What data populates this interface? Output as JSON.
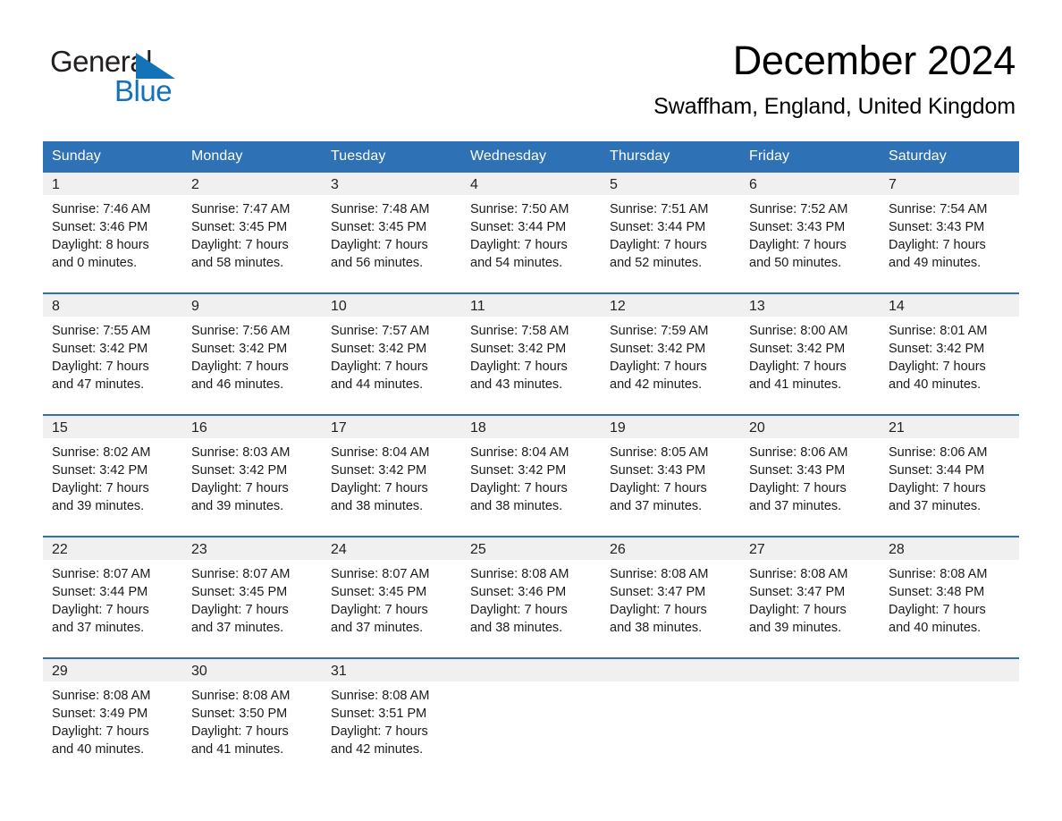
{
  "logo": {
    "word1": "General",
    "word2": "Blue",
    "triangle_color": "#1373b8",
    "text_color": "#231f20"
  },
  "header": {
    "title": "December 2024",
    "subtitle": "Swaffham, England, United Kingdom",
    "header_bg_color": "#2e71b5",
    "daynum_bg_color": "#f0f0f0"
  },
  "weekdays": [
    "Sunday",
    "Monday",
    "Tuesday",
    "Wednesday",
    "Thursday",
    "Friday",
    "Saturday"
  ],
  "weeks": [
    [
      {
        "day": "1",
        "sunrise": "Sunrise: 7:46 AM",
        "sunset": "Sunset: 3:46 PM",
        "daylight1": "Daylight: 8 hours",
        "daylight2": "and 0 minutes."
      },
      {
        "day": "2",
        "sunrise": "Sunrise: 7:47 AM",
        "sunset": "Sunset: 3:45 PM",
        "daylight1": "Daylight: 7 hours",
        "daylight2": "and 58 minutes."
      },
      {
        "day": "3",
        "sunrise": "Sunrise: 7:48 AM",
        "sunset": "Sunset: 3:45 PM",
        "daylight1": "Daylight: 7 hours",
        "daylight2": "and 56 minutes."
      },
      {
        "day": "4",
        "sunrise": "Sunrise: 7:50 AM",
        "sunset": "Sunset: 3:44 PM",
        "daylight1": "Daylight: 7 hours",
        "daylight2": "and 54 minutes."
      },
      {
        "day": "5",
        "sunrise": "Sunrise: 7:51 AM",
        "sunset": "Sunset: 3:44 PM",
        "daylight1": "Daylight: 7 hours",
        "daylight2": "and 52 minutes."
      },
      {
        "day": "6",
        "sunrise": "Sunrise: 7:52 AM",
        "sunset": "Sunset: 3:43 PM",
        "daylight1": "Daylight: 7 hours",
        "daylight2": "and 50 minutes."
      },
      {
        "day": "7",
        "sunrise": "Sunrise: 7:54 AM",
        "sunset": "Sunset: 3:43 PM",
        "daylight1": "Daylight: 7 hours",
        "daylight2": "and 49 minutes."
      }
    ],
    [
      {
        "day": "8",
        "sunrise": "Sunrise: 7:55 AM",
        "sunset": "Sunset: 3:42 PM",
        "daylight1": "Daylight: 7 hours",
        "daylight2": "and 47 minutes."
      },
      {
        "day": "9",
        "sunrise": "Sunrise: 7:56 AM",
        "sunset": "Sunset: 3:42 PM",
        "daylight1": "Daylight: 7 hours",
        "daylight2": "and 46 minutes."
      },
      {
        "day": "10",
        "sunrise": "Sunrise: 7:57 AM",
        "sunset": "Sunset: 3:42 PM",
        "daylight1": "Daylight: 7 hours",
        "daylight2": "and 44 minutes."
      },
      {
        "day": "11",
        "sunrise": "Sunrise: 7:58 AM",
        "sunset": "Sunset: 3:42 PM",
        "daylight1": "Daylight: 7 hours",
        "daylight2": "and 43 minutes."
      },
      {
        "day": "12",
        "sunrise": "Sunrise: 7:59 AM",
        "sunset": "Sunset: 3:42 PM",
        "daylight1": "Daylight: 7 hours",
        "daylight2": "and 42 minutes."
      },
      {
        "day": "13",
        "sunrise": "Sunrise: 8:00 AM",
        "sunset": "Sunset: 3:42 PM",
        "daylight1": "Daylight: 7 hours",
        "daylight2": "and 41 minutes."
      },
      {
        "day": "14",
        "sunrise": "Sunrise: 8:01 AM",
        "sunset": "Sunset: 3:42 PM",
        "daylight1": "Daylight: 7 hours",
        "daylight2": "and 40 minutes."
      }
    ],
    [
      {
        "day": "15",
        "sunrise": "Sunrise: 8:02 AM",
        "sunset": "Sunset: 3:42 PM",
        "daylight1": "Daylight: 7 hours",
        "daylight2": "and 39 minutes."
      },
      {
        "day": "16",
        "sunrise": "Sunrise: 8:03 AM",
        "sunset": "Sunset: 3:42 PM",
        "daylight1": "Daylight: 7 hours",
        "daylight2": "and 39 minutes."
      },
      {
        "day": "17",
        "sunrise": "Sunrise: 8:04 AM",
        "sunset": "Sunset: 3:42 PM",
        "daylight1": "Daylight: 7 hours",
        "daylight2": "and 38 minutes."
      },
      {
        "day": "18",
        "sunrise": "Sunrise: 8:04 AM",
        "sunset": "Sunset: 3:42 PM",
        "daylight1": "Daylight: 7 hours",
        "daylight2": "and 38 minutes."
      },
      {
        "day": "19",
        "sunrise": "Sunrise: 8:05 AM",
        "sunset": "Sunset: 3:43 PM",
        "daylight1": "Daylight: 7 hours",
        "daylight2": "and 37 minutes."
      },
      {
        "day": "20",
        "sunrise": "Sunrise: 8:06 AM",
        "sunset": "Sunset: 3:43 PM",
        "daylight1": "Daylight: 7 hours",
        "daylight2": "and 37 minutes."
      },
      {
        "day": "21",
        "sunrise": "Sunrise: 8:06 AM",
        "sunset": "Sunset: 3:44 PM",
        "daylight1": "Daylight: 7 hours",
        "daylight2": "and 37 minutes."
      }
    ],
    [
      {
        "day": "22",
        "sunrise": "Sunrise: 8:07 AM",
        "sunset": "Sunset: 3:44 PM",
        "daylight1": "Daylight: 7 hours",
        "daylight2": "and 37 minutes."
      },
      {
        "day": "23",
        "sunrise": "Sunrise: 8:07 AM",
        "sunset": "Sunset: 3:45 PM",
        "daylight1": "Daylight: 7 hours",
        "daylight2": "and 37 minutes."
      },
      {
        "day": "24",
        "sunrise": "Sunrise: 8:07 AM",
        "sunset": "Sunset: 3:45 PM",
        "daylight1": "Daylight: 7 hours",
        "daylight2": "and 37 minutes."
      },
      {
        "day": "25",
        "sunrise": "Sunrise: 8:08 AM",
        "sunset": "Sunset: 3:46 PM",
        "daylight1": "Daylight: 7 hours",
        "daylight2": "and 38 minutes."
      },
      {
        "day": "26",
        "sunrise": "Sunrise: 8:08 AM",
        "sunset": "Sunset: 3:47 PM",
        "daylight1": "Daylight: 7 hours",
        "daylight2": "and 38 minutes."
      },
      {
        "day": "27",
        "sunrise": "Sunrise: 8:08 AM",
        "sunset": "Sunset: 3:47 PM",
        "daylight1": "Daylight: 7 hours",
        "daylight2": "and 39 minutes."
      },
      {
        "day": "28",
        "sunrise": "Sunrise: 8:08 AM",
        "sunset": "Sunset: 3:48 PM",
        "daylight1": "Daylight: 7 hours",
        "daylight2": "and 40 minutes."
      }
    ],
    [
      {
        "day": "29",
        "sunrise": "Sunrise: 8:08 AM",
        "sunset": "Sunset: 3:49 PM",
        "daylight1": "Daylight: 7 hours",
        "daylight2": "and 40 minutes."
      },
      {
        "day": "30",
        "sunrise": "Sunrise: 8:08 AM",
        "sunset": "Sunset: 3:50 PM",
        "daylight1": "Daylight: 7 hours",
        "daylight2": "and 41 minutes."
      },
      {
        "day": "31",
        "sunrise": "Sunrise: 8:08 AM",
        "sunset": "Sunset: 3:51 PM",
        "daylight1": "Daylight: 7 hours",
        "daylight2": "and 42 minutes."
      },
      {
        "day": "",
        "sunrise": "",
        "sunset": "",
        "daylight1": "",
        "daylight2": ""
      },
      {
        "day": "",
        "sunrise": "",
        "sunset": "",
        "daylight1": "",
        "daylight2": ""
      },
      {
        "day": "",
        "sunrise": "",
        "sunset": "",
        "daylight1": "",
        "daylight2": ""
      },
      {
        "day": "",
        "sunrise": "",
        "sunset": "",
        "daylight1": "",
        "daylight2": ""
      }
    ]
  ]
}
